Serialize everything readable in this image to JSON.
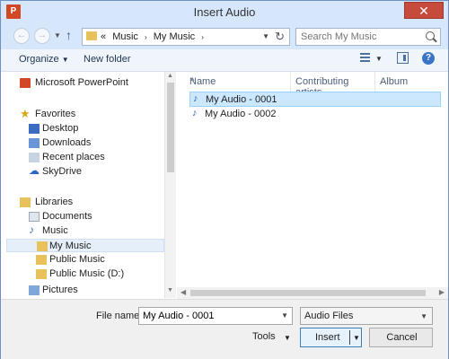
{
  "window": {
    "title": "Insert Audio",
    "app_icon_letter": "P"
  },
  "address": {
    "overflow": "«",
    "crumbs": [
      "Music",
      "My Music"
    ]
  },
  "search": {
    "placeholder": "Search My Music"
  },
  "toolbar": {
    "organize_label": "Organize",
    "new_folder_label": "New folder"
  },
  "nav": {
    "powerpoint": "Microsoft PowerPoint",
    "favorites_header": "Favorites",
    "favorites": [
      "Desktop",
      "Downloads",
      "Recent places",
      "SkyDrive"
    ],
    "libraries_header": "Libraries",
    "libraries": [
      "Documents",
      "Music",
      "My Music",
      "Public Music",
      "Public Music (D:)",
      "Pictures"
    ]
  },
  "columns": [
    "Name",
    "Contributing artists",
    "Album"
  ],
  "files": [
    {
      "name": "My Audio - 0001",
      "selected": true
    },
    {
      "name": "My Audio - 0002",
      "selected": false
    }
  ],
  "footer": {
    "file_name_label": "File name:",
    "file_name_value": "My Audio - 0001",
    "file_type": "Audio Files",
    "tools_label": "Tools",
    "insert_label": "Insert",
    "cancel_label": "Cancel"
  },
  "colors": {
    "accent": "#d6e6fb",
    "selection": "#cce8ff",
    "powerpoint": "#d24726"
  }
}
